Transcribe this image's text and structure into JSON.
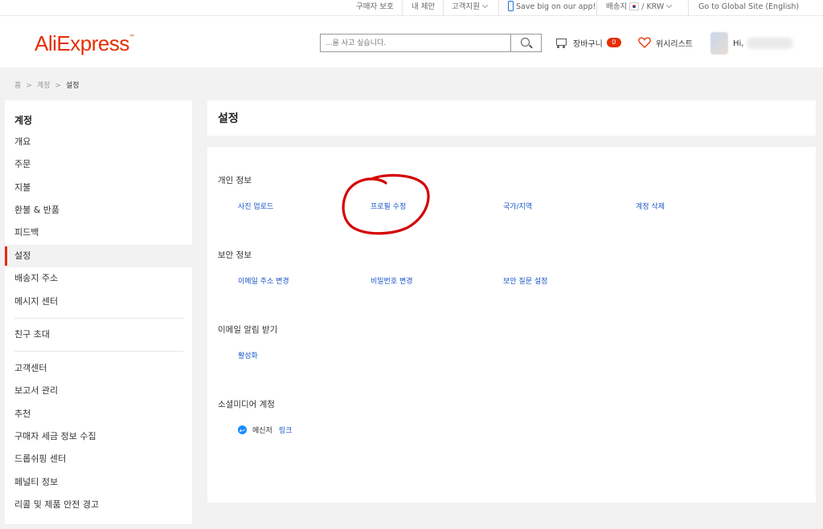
{
  "topbar": {
    "buyer_protection": "구매자 보호",
    "my_offers": "내 제안",
    "customer_support": "고객지원",
    "app_promo": "Save big on our app!",
    "ship_to": "배송지",
    "currency": "/ KRW",
    "global_site": "Go to Global Site (English)"
  },
  "header": {
    "logo": "AliExpress",
    "search_placeholder": "...을 사고 싶습니다.",
    "cart_label": "장바구니",
    "cart_count": "0",
    "wishlist_label": "위시리스트",
    "greeting": "Hi,"
  },
  "breadcrumb": {
    "home": "홈",
    "account": "계정",
    "current": "설정",
    "separator": ">"
  },
  "sidebar": {
    "title": "계정",
    "group1": [
      "개요",
      "주문",
      "지불",
      "환불 & 반품",
      "피드백",
      "설정",
      "배송지 주소",
      "메시지 센터"
    ],
    "group2": [
      "친구 초대"
    ],
    "group3": [
      "고객센터",
      "보고서 관리",
      "추천",
      "구매자 세금 정보 수집",
      "드롭쉬핑 센터",
      "페널티 정보",
      "리콜 및 제품 안전 경고"
    ],
    "active_item": "설정"
  },
  "main": {
    "title": "설정",
    "sections": {
      "personal": {
        "title": "개인 정보",
        "links": [
          "사진 업로드",
          "프로필 수정",
          "국가/지역",
          "계정 삭제"
        ]
      },
      "security": {
        "title": "보안 정보",
        "links": [
          "이메일 주소 변경",
          "비밀번호 변경",
          "보안 질문 설정"
        ]
      },
      "email_alerts": {
        "title": "이메일 알림 받기",
        "links": [
          "활성화"
        ]
      },
      "social": {
        "title": "소셜미디어 계정",
        "messenger_label": "메신저",
        "link_label": "링크"
      }
    }
  },
  "colors": {
    "brand": "#e62e04",
    "link": "#1a56c9",
    "annotation": "#d40000"
  },
  "icons": [
    "phone-icon",
    "korea-flag-icon",
    "search-icon",
    "cart-icon",
    "heart-icon",
    "avatar",
    "messenger-icon"
  ]
}
